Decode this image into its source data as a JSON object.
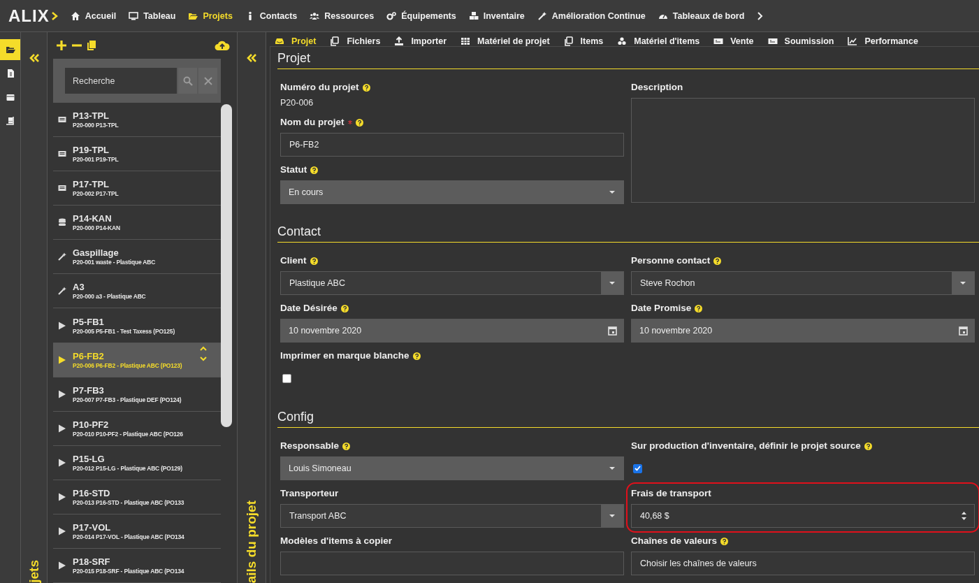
{
  "logo": {
    "text": "ALIX"
  },
  "nav": [
    {
      "label": "Accueil",
      "selected": false
    },
    {
      "label": "Tableau",
      "selected": false
    },
    {
      "label": "Projets",
      "selected": true
    },
    {
      "label": "Contacts",
      "selected": false
    },
    {
      "label": "Ressources",
      "selected": false
    },
    {
      "label": "Équipements",
      "selected": false
    },
    {
      "label": "Inventaire",
      "selected": false
    },
    {
      "label": "Amélioration Continue",
      "selected": false
    },
    {
      "label": "Tableaux de bord",
      "selected": false
    }
  ],
  "rail": [
    {
      "selected": true
    },
    {
      "selected": false
    },
    {
      "selected": false
    },
    {
      "selected": false
    }
  ],
  "projects_strip": {
    "label": "jets"
  },
  "project_list": {
    "search": {
      "placeholder": "Recherche"
    },
    "items": [
      {
        "kind": "template",
        "title": "P13-TPL",
        "subtitle": "P20-000 P13-TPL",
        "selected": false
      },
      {
        "kind": "template",
        "title": "P19-TPL",
        "subtitle": "P20-001 P19-TPL",
        "selected": false
      },
      {
        "kind": "template",
        "title": "P17-TPL",
        "subtitle": "P20-002 P17-TPL",
        "selected": false
      },
      {
        "kind": "kanban",
        "title": "P14-KAN",
        "subtitle": "P20-000 P14-KAN",
        "selected": false
      },
      {
        "kind": "improvement",
        "title": "Gaspillage",
        "subtitle": "P20-001 waste - Plastique ABC",
        "selected": false
      },
      {
        "kind": "improvement",
        "title": "A3",
        "subtitle": "P20-000 a3 - Plastique ABC",
        "selected": false
      },
      {
        "kind": "project",
        "title": "P5-FB1",
        "subtitle": "P20-005 P5-FB1 - Test Taxess (PO125)",
        "selected": false
      },
      {
        "kind": "project",
        "title": "P6-FB2",
        "subtitle": "P20-006 P6-FB2 - Plastique ABC (PO123)",
        "selected": true
      },
      {
        "kind": "project",
        "title": "P7-FB3",
        "subtitle": "P20-007 P7-FB3 - Plastique DEF (PO124)",
        "selected": false
      },
      {
        "kind": "project",
        "title": "P10-PF2",
        "subtitle": "P20-010 P10-PF2 - Plastique ABC (PO126",
        "selected": false
      },
      {
        "kind": "project",
        "title": "P15-LG",
        "subtitle": "P20-012 P15-LG - Plastique ABC (PO129)",
        "selected": false
      },
      {
        "kind": "project",
        "title": "P16-STD",
        "subtitle": "P20-013 P16-STD - Plastique ABC (PO133",
        "selected": false
      },
      {
        "kind": "project",
        "title": "P17-VOL",
        "subtitle": "P20-014 P17-VOL - Plastique ABC (PO134",
        "selected": false
      },
      {
        "kind": "project",
        "title": "P18-SRF",
        "subtitle": "P20-015 P18-SRF - Plastique ABC (PO134",
        "selected": false
      }
    ]
  },
  "details_strip": {
    "label": "ails du projet"
  },
  "tabs": [
    {
      "label": "Projet",
      "selected": true
    },
    {
      "label": "Fichiers",
      "selected": false
    },
    {
      "label": "Importer",
      "selected": false
    },
    {
      "label": "Matériel de projet",
      "selected": false
    },
    {
      "label": "Items",
      "selected": false
    },
    {
      "label": "Matériel d'items",
      "selected": false
    },
    {
      "label": "Vente",
      "selected": false
    },
    {
      "label": "Soumission",
      "selected": false
    },
    {
      "label": "Performance",
      "selected": false
    }
  ],
  "sections": [
    {
      "title": "Projet",
      "columns": [
        [
          {
            "kind": "static",
            "label": "Numéro du projet",
            "help": true,
            "value": "P20-006"
          },
          {
            "kind": "text",
            "label": "Nom du projet",
            "help": true,
            "required": true,
            "value": "P6-FB2"
          },
          {
            "kind": "select",
            "label": "Statut",
            "help": true,
            "value": "En cours"
          }
        ],
        [
          {
            "kind": "textarea",
            "label": "Description"
          }
        ]
      ]
    },
    {
      "title": "Contact",
      "columns": [
        [
          {
            "kind": "combo",
            "label": "Client",
            "help": true,
            "value": "Plastique ABC"
          },
          {
            "kind": "date",
            "label": "Date Désirée",
            "help": true,
            "value": "10 novembre 2020"
          },
          {
            "kind": "checkbox",
            "label": "Imprimer en marque blanche",
            "help": true,
            "checked": false
          }
        ],
        [
          {
            "kind": "combo",
            "label": "Personne contact",
            "help": true,
            "value": "Steve Rochon"
          },
          {
            "kind": "date",
            "label": "Date Promise",
            "help": true,
            "value": "10 novembre 2020"
          }
        ]
      ]
    },
    {
      "title": "Config",
      "columns": [
        [
          {
            "kind": "select",
            "label": "Responsable",
            "help": true,
            "value": "Louis Simoneau"
          },
          {
            "kind": "combo",
            "label": "Transporteur",
            "value": "Transport ABC"
          },
          {
            "kind": "text",
            "label": "Modèles d'items à copier"
          }
        ],
        [
          {
            "kind": "checkbox",
            "label": "Sur production d'inventaire, définir le projet source",
            "help": true,
            "checked": true
          },
          {
            "kind": "number",
            "label": "Frais de transport",
            "highlighted": true,
            "value": "40,68 $"
          },
          {
            "kind": "multiselect",
            "label": "Chaînes de valeurs",
            "help": true,
            "placeholder": "Choisir les chaînes de valeurs"
          }
        ]
      ]
    }
  ]
}
